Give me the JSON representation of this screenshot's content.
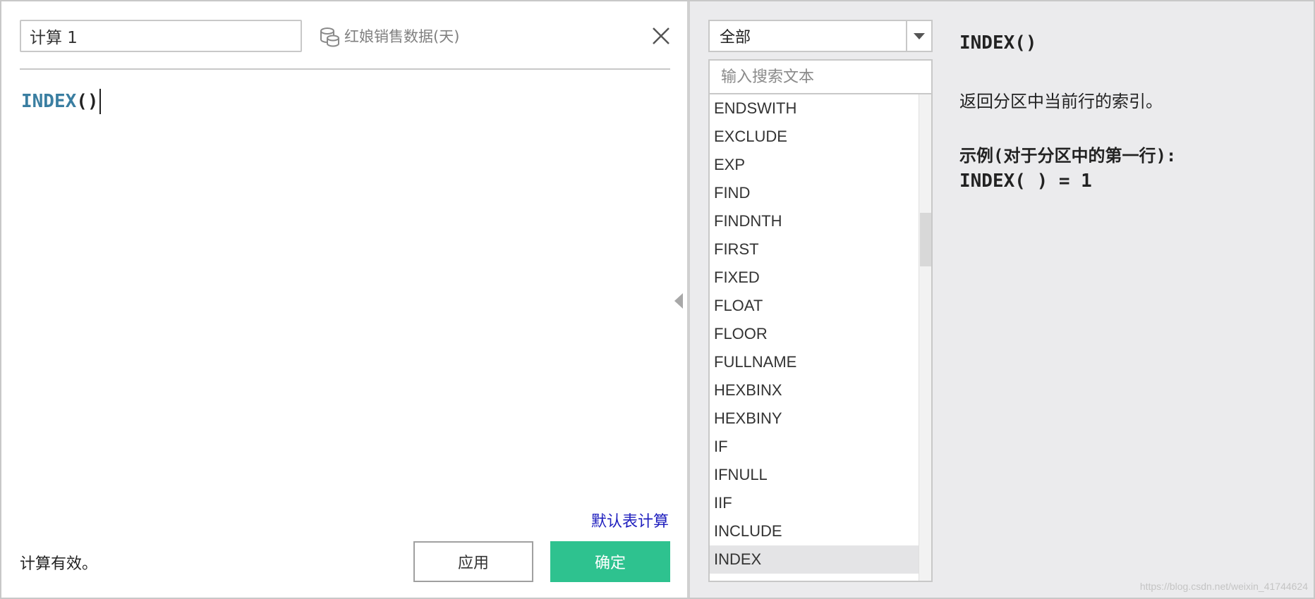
{
  "editor_header": {
    "calc_name": "计算 1",
    "datasource_icon": "database-icon",
    "datasource_name": "红娘销售数据(天)",
    "close_icon": "close-icon"
  },
  "editor": {
    "function_name": "INDEX",
    "parens": "()"
  },
  "footer": {
    "default_table_calc_link": "默认表计算",
    "status": "计算有效。",
    "apply_label": "应用",
    "ok_label": "确定"
  },
  "reference": {
    "category_selected": "全部",
    "search_placeholder": "输入搜索文本",
    "functions": [
      "ENDSWITH",
      "EXCLUDE",
      "EXP",
      "FIND",
      "FINDNTH",
      "FIRST",
      "FIXED",
      "FLOAT",
      "FLOOR",
      "FULLNAME",
      "HEXBINX",
      "HEXBINY",
      "IF",
      "IFNULL",
      "IIF",
      "INCLUDE",
      "INDEX"
    ],
    "selected_function": "INDEX",
    "help_title": "INDEX()",
    "help_description": "返回分区中当前行的索引。",
    "help_example_label": "示例(对于分区中的第一行):",
    "help_example_code": "INDEX( ) = 1"
  },
  "watermark": "https://blog.csdn.net/weixin_41744624",
  "colors": {
    "accent_green": "#2ec28f",
    "link_blue": "#1f1fbe",
    "function_blue": "#3a7ea1",
    "panel_gray": "#ebebed"
  }
}
